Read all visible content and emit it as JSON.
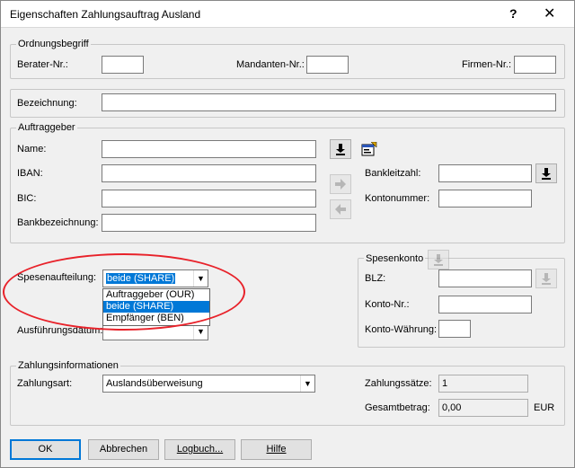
{
  "window": {
    "title": "Eigenschaften Zahlungsauftrag Ausland",
    "help_glyph": "?",
    "close_glyph": "✕"
  },
  "ordnung": {
    "legend": "Ordnungsbegriff",
    "berater_label": "Berater-Nr.:",
    "berater_value": "",
    "mandanten_label": "Mandanten-Nr.:",
    "mandanten_value": "",
    "firmen_label": "Firmen-Nr.:",
    "firmen_value": ""
  },
  "bezeichnung": {
    "label": "Bezeichnung:",
    "value": ""
  },
  "auftraggeber": {
    "legend": "Auftraggeber",
    "name_label": "Name:",
    "name_value": "",
    "iban_label": "IBAN:",
    "iban_value": "",
    "bic_label": "BIC:",
    "bic_value": "",
    "bankbez_label": "Bankbezeichnung:",
    "bankbez_value": "",
    "bankleitzahl_label": "Bankleitzahl:",
    "bankleitzahl_value": "",
    "kontonummer_label": "Kontonummer:",
    "kontonummer_value": ""
  },
  "spesen": {
    "aufteilung_label": "Spesenaufteilung:",
    "aufteilung_selected": "beide (SHARE)",
    "options": [
      "Auftraggeber (OUR)",
      "beide (SHARE)",
      "Empfänger (BEN)"
    ],
    "ausfuehrung_label": "Ausführungsdatum:"
  },
  "spesenkonto": {
    "legend": "Spesenkonto",
    "blz_label": "BLZ:",
    "blz_value": "",
    "konto_label": "Konto-Nr.:",
    "konto_value": "",
    "waehrung_label": "Konto-Währung:",
    "waehrung_value": ""
  },
  "zahlung": {
    "legend": "Zahlungsinformationen",
    "art_label": "Zahlungsart:",
    "art_value": "Auslandsüberweisung",
    "saetze_label": "Zahlungssätze:",
    "saetze_value": "1",
    "betrag_label": "Gesamtbetrag:",
    "betrag_value": "0,00",
    "currency": "EUR"
  },
  "buttons": {
    "ok": "OK",
    "abbrechen": "Abbrechen",
    "logbuch": "Logbuch...",
    "hilfe": "Hilfe"
  },
  "colors": {
    "selection": "#0078d7",
    "annotation": "#e8222a",
    "dialog_bg": "#f0f0f0"
  },
  "icons": [
    "download-icon",
    "properties-icon",
    "arrow-right-icon",
    "arrow-left-icon"
  ]
}
